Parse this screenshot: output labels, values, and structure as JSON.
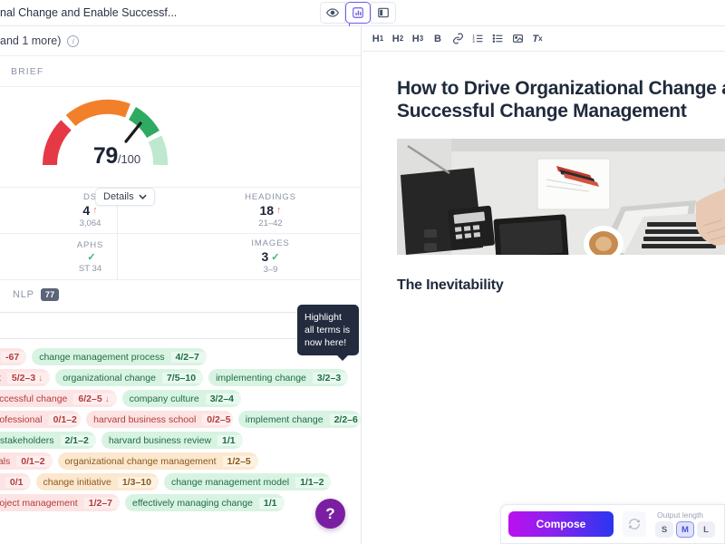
{
  "topbar": {
    "document_title": "nal Change and Enable Successf...",
    "view_buttons": [
      {
        "name": "preview-view",
        "icon": "eye-icon",
        "active": false
      },
      {
        "name": "optimize-view",
        "icon": "analytics-icon",
        "active": true
      },
      {
        "name": "split-view",
        "icon": "panel-layout-icon",
        "active": false
      }
    ]
  },
  "left_panel": {
    "keywords_line": "and 1 more)",
    "brief_label": "BRIEF",
    "gauge": {
      "score": "79",
      "denominator": "/100",
      "colors": {
        "red": "#e63946",
        "orange": "#f2802a",
        "green": "#2eaa63",
        "green_light": "#bee8cf",
        "needle": "#1a1a1a"
      }
    },
    "details_button": "Details",
    "stats": [
      {
        "label": "DS",
        "value": "4",
        "indicator": "up",
        "range": "3,064"
      },
      {
        "label": "HEADINGS",
        "value": "18",
        "indicator": "up",
        "range": "21–42"
      },
      {
        "label": "APHS",
        "value": "",
        "indicator": "check",
        "range": "ST 34"
      },
      {
        "label": "IMAGES",
        "value": "3",
        "indicator": "check",
        "range": "3–9"
      }
    ],
    "nlp": {
      "label": "NLP",
      "badge": "77"
    },
    "tooltip": "Highlight all terms is now here!",
    "tag_rows": [
      [
        {
          "name": "",
          "count": "-67",
          "color": "red",
          "dir": ""
        },
        {
          "name": "change management process",
          "count": "4/2–7",
          "color": "green",
          "dir": ""
        }
      ],
      [
        {
          "name": "t",
          "count": "5/2–3",
          "color": "red",
          "dir": "down"
        },
        {
          "name": "organizational change",
          "count": "7/5–10",
          "color": "green",
          "dir": ""
        },
        {
          "name": "implementing change",
          "count": "3/2–3",
          "color": "green",
          "dir": ""
        }
      ],
      [
        {
          "name": "successful change",
          "count": "6/2–5",
          "color": "red",
          "dir": "down"
        },
        {
          "name": "company culture",
          "count": "3/2–4",
          "color": "green",
          "dir": ""
        }
      ],
      [
        {
          "name": "professional",
          "count": "0/1–2",
          "color": "red",
          "dir": ""
        },
        {
          "name": "harvard business school",
          "count": "0/2–5",
          "color": "red",
          "dir": ""
        },
        {
          "name": "implement change",
          "count": "2/2–6",
          "color": "green",
          "dir": ""
        }
      ],
      [
        {
          "name": "ey stakeholders",
          "count": "2/1–2",
          "color": "green",
          "dir": ""
        },
        {
          "name": "harvard business review",
          "count": "1/1",
          "color": "green",
          "dir": ""
        }
      ],
      [
        {
          "name": "nals",
          "count": "0/1–2",
          "color": "red",
          "dir": ""
        },
        {
          "name": "organizational change management",
          "count": "1/2–5",
          "color": "orange",
          "dir": ""
        }
      ],
      [
        {
          "name": "t",
          "count": "0/1",
          "color": "red",
          "dir": ""
        },
        {
          "name": "change initiative",
          "count": "1/3–10",
          "color": "orange",
          "dir": ""
        },
        {
          "name": "change management model",
          "count": "1/1–2",
          "color": "green",
          "dir": ""
        }
      ],
      [
        {
          "name": "project management",
          "count": "1/2–7",
          "color": "red",
          "dir": ""
        },
        {
          "name": "effectively managing change",
          "count": "1/1",
          "color": "green",
          "dir": ""
        }
      ]
    ],
    "help_button": "?"
  },
  "right_panel": {
    "toolbar": [
      {
        "name": "heading-1-button",
        "label": "H",
        "sub": "1"
      },
      {
        "name": "heading-2-button",
        "label": "H",
        "sub": "2"
      },
      {
        "name": "heading-3-button",
        "label": "H",
        "sub": "3"
      },
      {
        "name": "bold-button",
        "label": "B",
        "sub": ""
      },
      {
        "name": "link-icon",
        "label": "link",
        "sub": ""
      },
      {
        "name": "ordered-list-icon",
        "label": "ol",
        "sub": ""
      },
      {
        "name": "unordered-list-icon",
        "label": "ul",
        "sub": ""
      },
      {
        "name": "image-icon",
        "label": "img",
        "sub": ""
      },
      {
        "name": "clear-format-icon",
        "label": "T",
        "sub": "x"
      }
    ],
    "doc_heading": "How to Drive Organizational Change and En Successful Change Management",
    "doc_heading_line1": "How to Drive Organizational Change and En",
    "doc_heading_line2": "Successful Change Management",
    "doc_subheading": "The Inevitability",
    "image_alt": "person typing on laptop at white desk with notebook, pens and coffee"
  },
  "compose": {
    "button_label": "Compose",
    "refresh_icon": "refresh-icon",
    "output_length_label": "Output length",
    "sizes": [
      {
        "label": "S",
        "active": false
      },
      {
        "label": "M",
        "active": true
      },
      {
        "label": "L",
        "active": false
      }
    ]
  }
}
